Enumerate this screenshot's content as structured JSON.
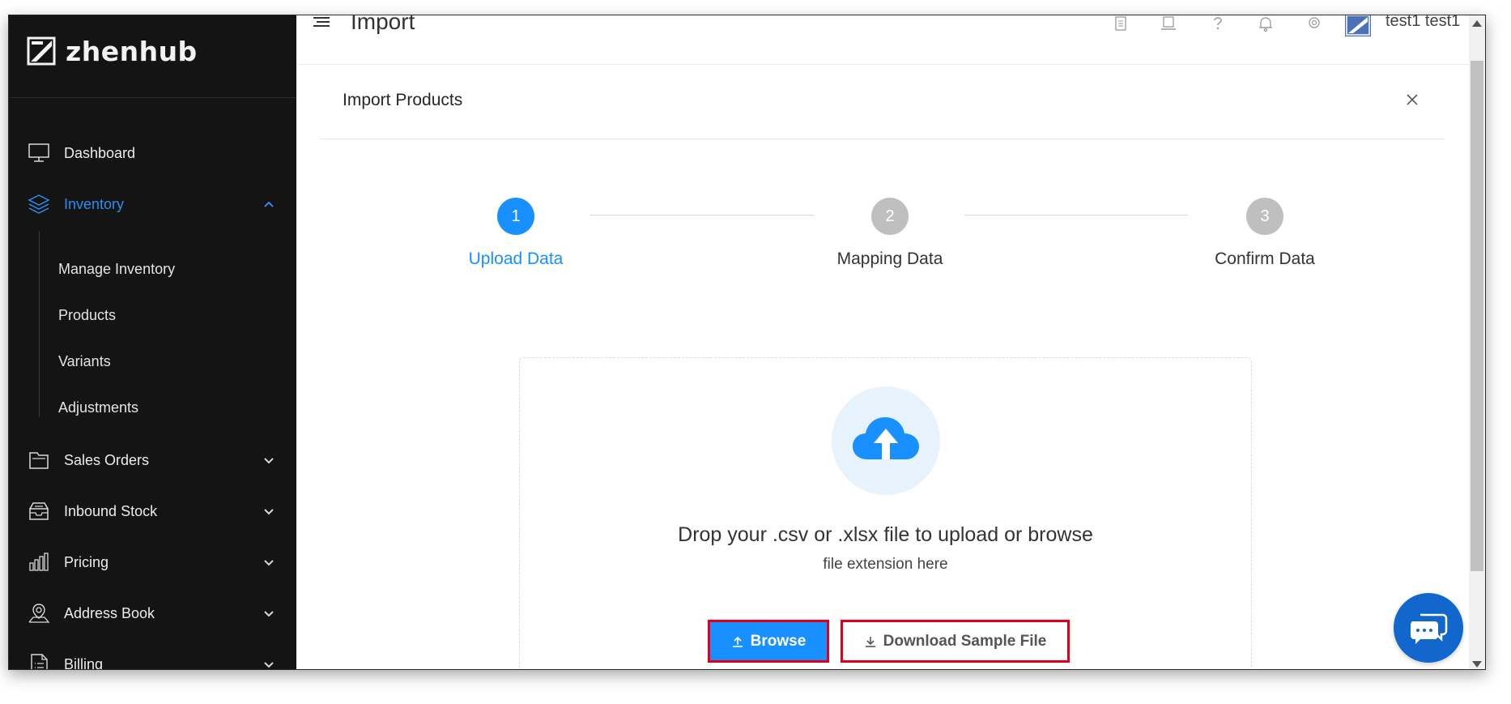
{
  "brand": {
    "name": "zhenhub"
  },
  "sidebar": {
    "items": [
      {
        "label": "Dashboard",
        "icon": "monitor-icon"
      },
      {
        "label": "Inventory",
        "icon": "layers-icon",
        "active": true,
        "expanded": true
      },
      {
        "label": "Sales Orders",
        "icon": "folder-icon"
      },
      {
        "label": "Inbound Stock",
        "icon": "inbox-icon"
      },
      {
        "label": "Pricing",
        "icon": "bar-chart-icon"
      },
      {
        "label": "Address Book",
        "icon": "map-pin-icon"
      },
      {
        "label": "Billing",
        "icon": "document-icon"
      }
    ],
    "inventory_subitems": [
      {
        "label": "Manage Inventory"
      },
      {
        "label": "Products"
      },
      {
        "label": "Variants"
      },
      {
        "label": "Adjustments"
      }
    ]
  },
  "header": {
    "title": "Import",
    "user_name": "test1 test1",
    "icons": [
      "clipboard-icon",
      "laptop-icon",
      "help-icon",
      "bell-icon",
      "settings-icon"
    ]
  },
  "modal": {
    "title": "Import Products",
    "steps": [
      {
        "number": "1",
        "label": "Upload Data",
        "state": "active"
      },
      {
        "number": "2",
        "label": "Mapping Data",
        "state": "pending"
      },
      {
        "number": "3",
        "label": "Confirm Data",
        "state": "pending"
      }
    ],
    "dropzone": {
      "text": "Drop your .csv or .xlsx file to upload or browse",
      "subtext": "file extension here"
    },
    "browse_label": "Browse",
    "download_label": "Download Sample File"
  },
  "colors": {
    "accent": "#1890ff",
    "sidebar_bg": "#141414",
    "step_pending": "#bfbfbf",
    "highlight_border": "#e0001b",
    "chat": "#1267cd"
  }
}
